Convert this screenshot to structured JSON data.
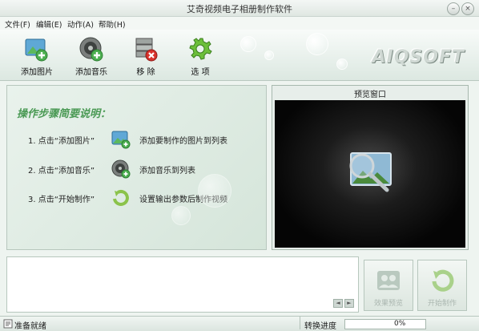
{
  "window": {
    "title": "艾奇视频电子相册制作软件"
  },
  "menu": [
    "文件(F)",
    "编辑(E)",
    "动作(A)",
    "帮助(H)"
  ],
  "toolbar": {
    "add_image": "添加图片",
    "add_music": "添加音乐",
    "remove": "移 除",
    "options": "选 项",
    "logo": "AIQSOFT"
  },
  "steps": {
    "title": "操作步骤简要说明：",
    "items": [
      {
        "label": "1. 点击“添加图片”",
        "desc": "添加要制作的图片到列表"
      },
      {
        "label": "2. 点击“添加音乐”",
        "desc": "添加音乐到列表"
      },
      {
        "label": "3. 点击“开始制作”",
        "desc": "设置输出参数后制作视频"
      }
    ]
  },
  "preview": {
    "title": "预览窗口"
  },
  "actions": {
    "effect_preview": "效果预览",
    "start": "开始制作"
  },
  "status": {
    "ready": "准备就绪",
    "progress_label": "转换进度",
    "progress_value": "0%"
  },
  "colors": {
    "accent_green": "#4b9a55",
    "remove_red": "#d8322c"
  }
}
